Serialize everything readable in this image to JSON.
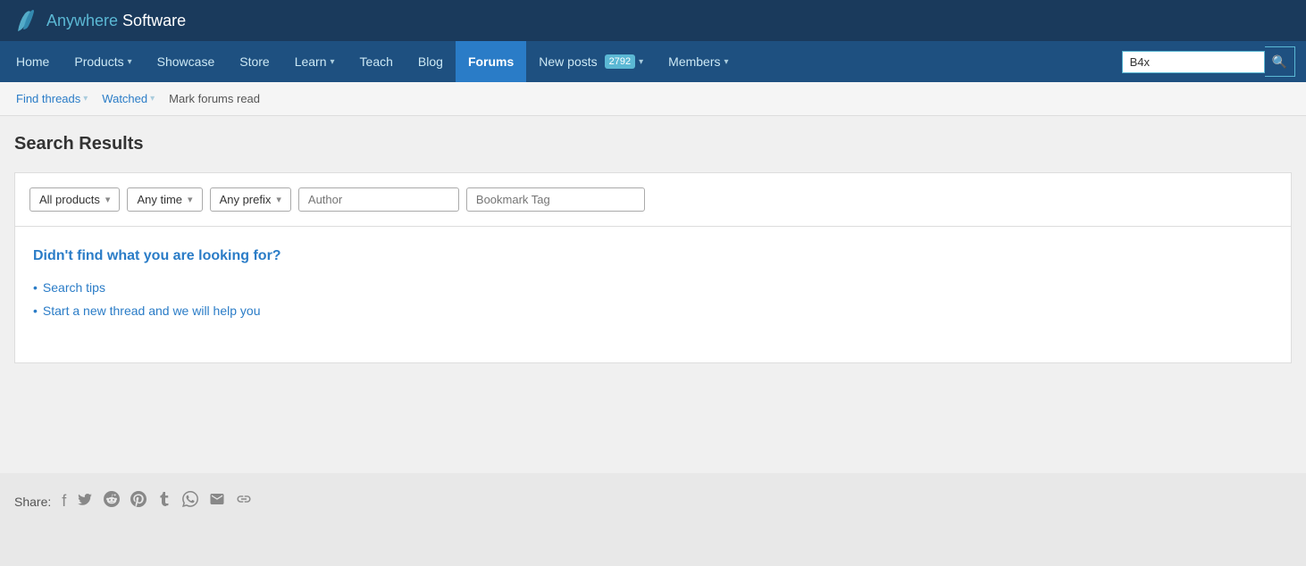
{
  "brand": {
    "name_part1": "Anywhere",
    "name_part2": " Software"
  },
  "nav": {
    "items": [
      {
        "id": "home",
        "label": "Home",
        "has_dropdown": false,
        "active": false
      },
      {
        "id": "products",
        "label": "Products",
        "has_dropdown": true,
        "active": false
      },
      {
        "id": "showcase",
        "label": "Showcase",
        "has_dropdown": false,
        "active": false
      },
      {
        "id": "store",
        "label": "Store",
        "has_dropdown": false,
        "active": false
      },
      {
        "id": "learn",
        "label": "Learn",
        "has_dropdown": true,
        "active": false
      },
      {
        "id": "teach",
        "label": "Teach",
        "has_dropdown": false,
        "active": false
      },
      {
        "id": "blog",
        "label": "Blog",
        "has_dropdown": false,
        "active": false
      },
      {
        "id": "forums",
        "label": "Forums",
        "has_dropdown": false,
        "active": true
      },
      {
        "id": "new-posts",
        "label": "New posts",
        "has_dropdown": true,
        "active": false,
        "badge": "2792"
      },
      {
        "id": "members",
        "label": "Members",
        "has_dropdown": true,
        "active": false
      }
    ],
    "search_placeholder": "B4x",
    "search_value": "B4x"
  },
  "sub_nav": {
    "find_threads": "Find threads",
    "watched": "Watched",
    "mark_forums_read": "Mark forums read"
  },
  "page": {
    "title": "Search Results"
  },
  "filters": {
    "products_label": "All products",
    "time_label": "Any time",
    "prefix_label": "Any prefix",
    "author_placeholder": "Author",
    "bookmark_placeholder": "Bookmark Tag"
  },
  "no_results": {
    "heading": "Didn't find what you are looking for?",
    "items": [
      {
        "label": "Search tips",
        "href": "#"
      },
      {
        "label": "Start a new thread and we will help you",
        "href": "#"
      }
    ]
  },
  "share": {
    "label": "Share:"
  }
}
